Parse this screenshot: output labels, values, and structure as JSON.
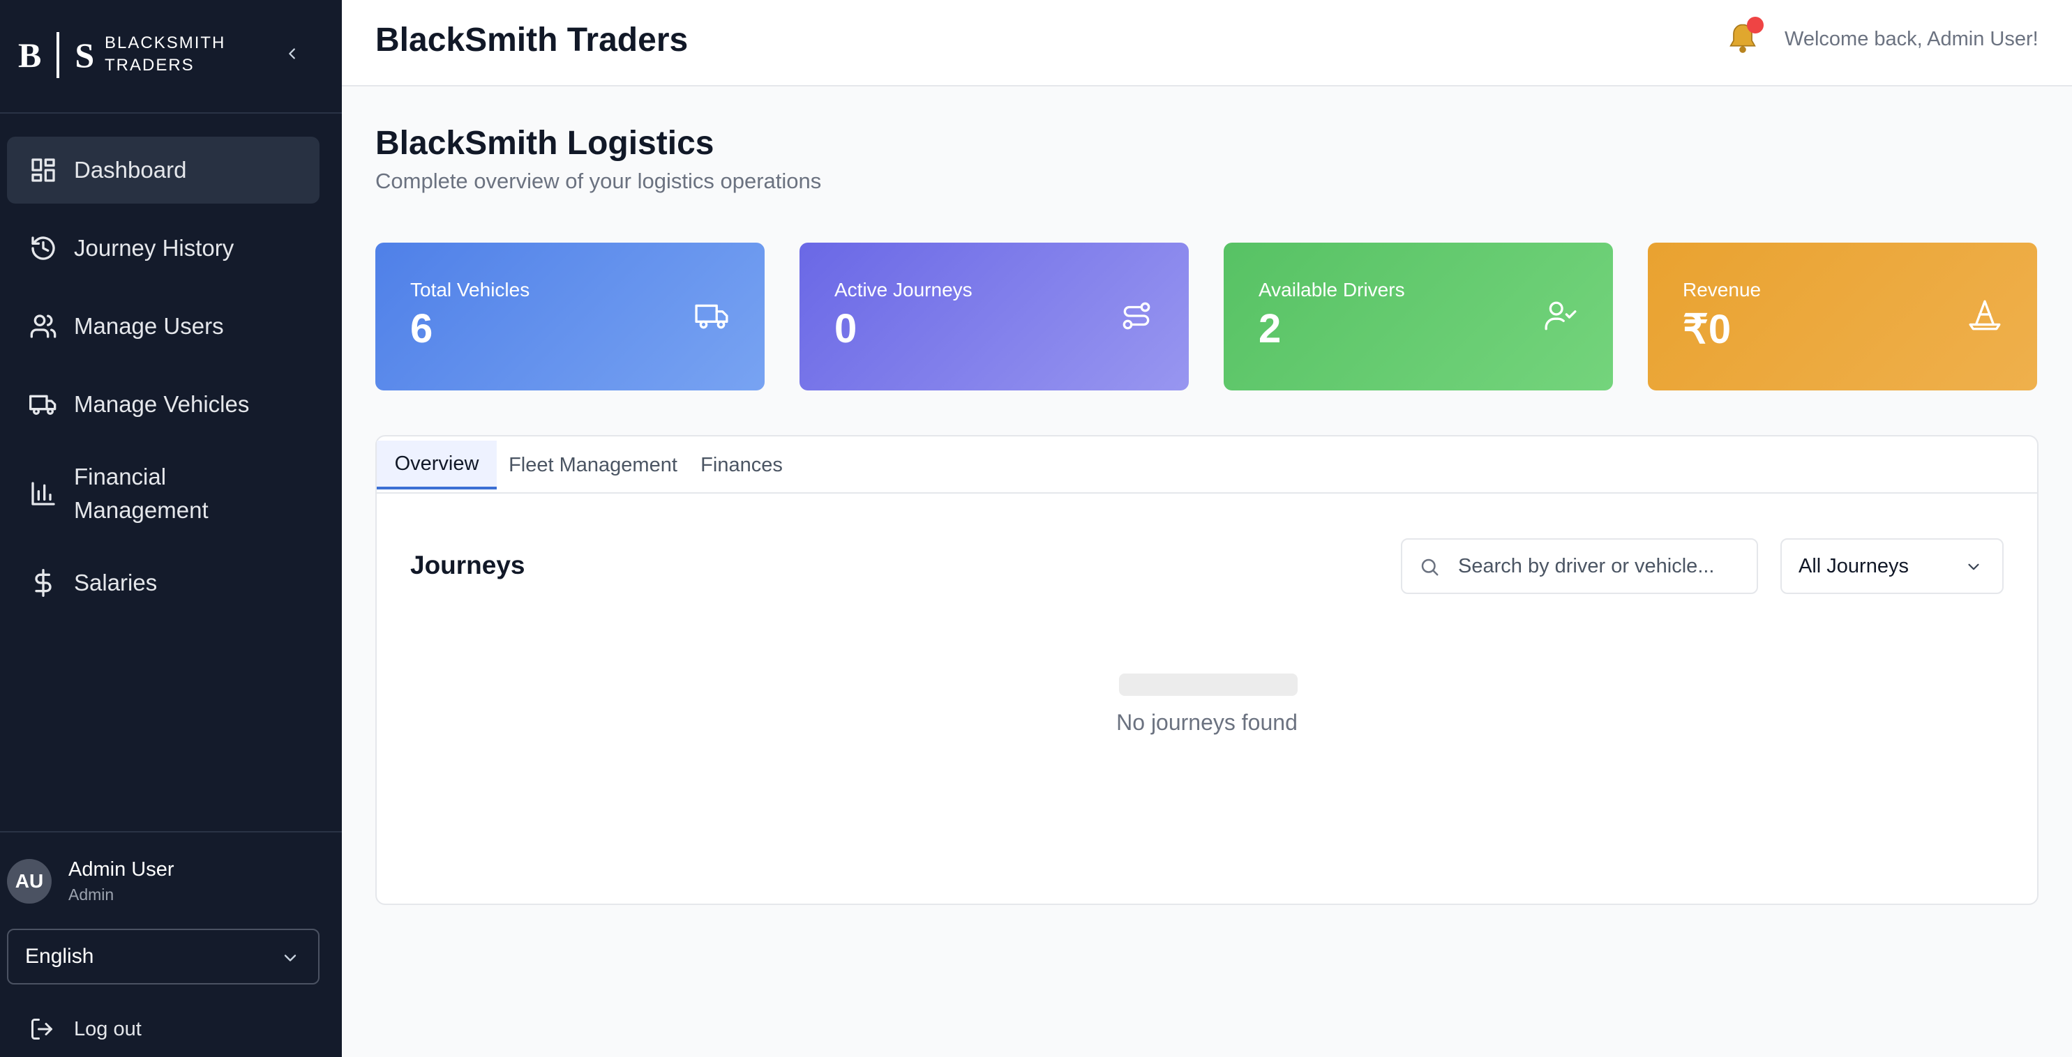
{
  "sidebar": {
    "brand": {
      "logo_left": "B",
      "logo_right": "S",
      "name_line1": "BLACKSMITH",
      "name_line2": "TRADERS"
    },
    "items": [
      {
        "label": "Dashboard",
        "icon": "dashboard-icon",
        "active": true
      },
      {
        "label": "Journey History",
        "icon": "history-icon"
      },
      {
        "label": "Manage Users",
        "icon": "users-icon"
      },
      {
        "label": "Manage Vehicles",
        "icon": "truck-icon"
      },
      {
        "label": "Financial Management",
        "label_line1": "Financial",
        "label_line2": "Management",
        "icon": "bar-chart-icon"
      },
      {
        "label": "Salaries",
        "icon": "dollar-icon"
      }
    ],
    "user": {
      "initials": "AU",
      "name": "Admin User",
      "role": "Admin"
    },
    "language": "English",
    "logout_label": "Log out"
  },
  "header": {
    "title": "BlackSmith Traders",
    "welcome": "Welcome back, Admin User!"
  },
  "main": {
    "title": "BlackSmith Logistics",
    "subtitle": "Complete overview of your logistics operations",
    "cards": [
      {
        "label": "Total Vehicles",
        "value": "6",
        "icon": "truck-icon",
        "color": "#5b8def"
      },
      {
        "label": "Active Journeys",
        "value": "0",
        "icon": "route-icon",
        "color": "#7a73ea"
      },
      {
        "label": "Available Drivers",
        "value": "2",
        "icon": "user-check-icon",
        "color": "#63cc6e"
      },
      {
        "label": "Revenue",
        "value": "₹0",
        "icon": "cone-icon",
        "color": "#eaa63b"
      }
    ],
    "tabs": [
      {
        "label": "Overview",
        "active": true
      },
      {
        "label": "Fleet Management"
      },
      {
        "label": "Finances"
      }
    ],
    "journeys": {
      "title": "Journeys",
      "search_placeholder": "Search by driver or vehicle...",
      "filter_value": "All Journeys",
      "empty_text": "No journeys found"
    }
  },
  "colors": {
    "sidebar_bg": "#141b2b",
    "active_nav": "#283142",
    "accent": "#3b6fd4",
    "notification": "#ef4444"
  }
}
